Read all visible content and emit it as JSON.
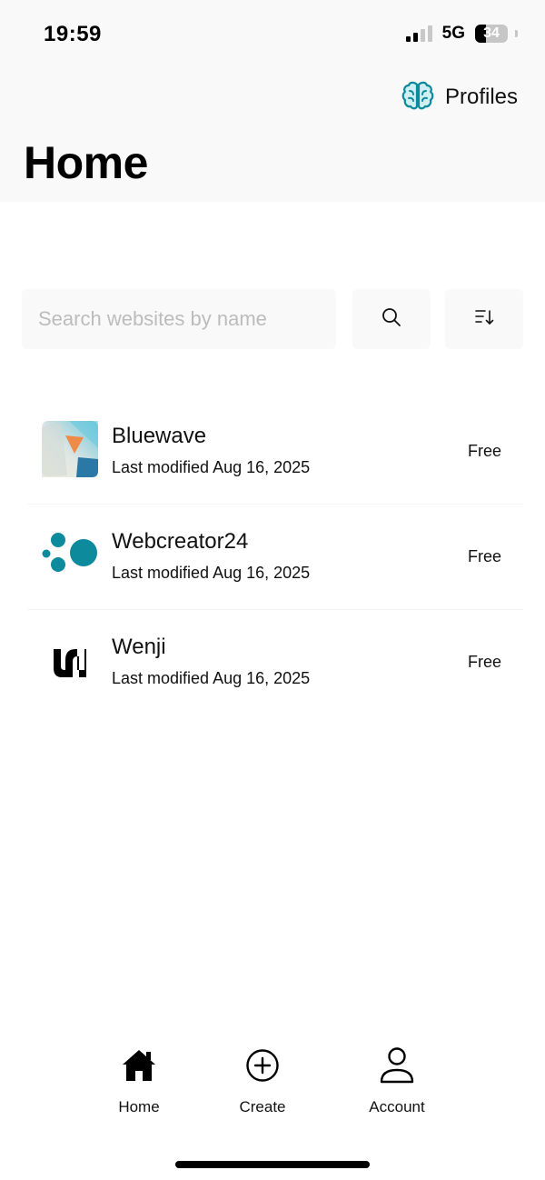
{
  "status_bar": {
    "time": "19:59",
    "network": "5G",
    "battery_level": "34"
  },
  "header": {
    "profiles_label": "Profiles",
    "profiles_icon": "brain-icon",
    "title": "Home"
  },
  "search": {
    "placeholder": "Search websites by name",
    "value": "",
    "search_icon": "search-icon",
    "sort_icon": "sort-icon"
  },
  "sites": [
    {
      "name": "Bluewave",
      "modified": "Last modified Aug 16, 2025",
      "plan": "Free",
      "icon": "bluewave-logo"
    },
    {
      "name": "Webcreator24",
      "modified": "Last modified Aug 16, 2025",
      "plan": "Free",
      "icon": "webcreator24-logo"
    },
    {
      "name": "Wenji",
      "modified": "Last modified Aug 16, 2025",
      "plan": "Free",
      "icon": "wenji-logo"
    }
  ],
  "nav": {
    "home": "Home",
    "create": "Create",
    "account": "Account"
  },
  "colors": {
    "accent_teal": "#0d8a9c",
    "surface": "#f9f9f9",
    "placeholder": "#bcbcbc"
  }
}
